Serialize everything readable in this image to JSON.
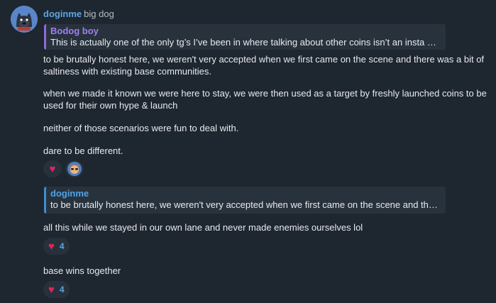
{
  "message": {
    "author": "doginme",
    "author_title": "big dog",
    "reply": {
      "author": "Bodog boy",
      "text": "This is actually one of the only tg’s I’ve been in where talking about other coins isn’t an insta ban lol"
    },
    "paragraphs": [
      "to be brutally honest here, we weren't very accepted when we first came on the scene and there was a bit of saltiness with existing base communities.",
      "when we made it known we were here to stay, we were then used as a target by freshly launched coins to be used for their own hype & launch",
      "neither of those scenarios were fun to deal with.",
      "dare to be different."
    ],
    "reactions": [
      {
        "icon": "heart-icon"
      },
      {
        "icon": "user-avatar"
      }
    ]
  },
  "message2": {
    "reply": {
      "author": "doginme",
      "text": "to be brutally honest here, we weren't very accepted when we first came on the scene and there w..."
    },
    "text": "all this while we stayed in our own lane and never made enemies ourselves lol",
    "reaction_count": "4"
  },
  "message3": {
    "text": "base wins together",
    "reaction_count": "4"
  },
  "colors": {
    "background": "#1e2630",
    "accent": "#5aa6e6",
    "reply_purple": "#8c6bd8",
    "reply_blue": "#3a8fd6",
    "heart": "#e0245e"
  }
}
